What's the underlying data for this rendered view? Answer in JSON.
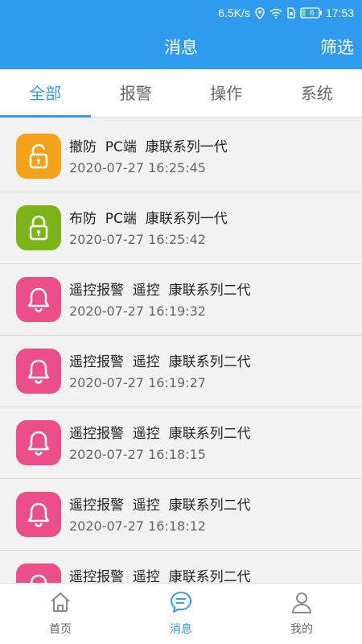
{
  "status_bar": {
    "speed": "6.5K/s",
    "battery": "6",
    "time": "17:53",
    "icons": [
      "location-icon",
      "wifi-icon",
      "sim-icon",
      "battery-icon"
    ]
  },
  "header": {
    "title": "消息",
    "filter_label": "筛选"
  },
  "tabs": [
    {
      "label": "全部",
      "active": true
    },
    {
      "label": "报警",
      "active": false
    },
    {
      "label": "操作",
      "active": false
    },
    {
      "label": "系统",
      "active": false
    }
  ],
  "messages": [
    {
      "title": "撤防  PC端  康联系列一代",
      "time": "2020-07-27 16:25:45",
      "icon": "unlock-icon",
      "color": "#f5a21b"
    },
    {
      "title": "布防  PC端  康联系列一代",
      "time": "2020-07-27 16:25:42",
      "icon": "lock-icon",
      "color": "#7cb518"
    },
    {
      "title": "遥控报警  遥控  康联系列二代",
      "time": "2020-07-27 16:19:32",
      "icon": "bell-icon",
      "color": "#ec4e8a"
    },
    {
      "title": "遥控报警  遥控  康联系列二代",
      "time": "2020-07-27 16:19:27",
      "icon": "bell-icon",
      "color": "#ec4e8a"
    },
    {
      "title": "遥控报警  遥控  康联系列二代",
      "time": "2020-07-27 16:18:15",
      "icon": "bell-icon",
      "color": "#ec4e8a"
    },
    {
      "title": "遥控报警  遥控  康联系列二代",
      "time": "2020-07-27 16:18:12",
      "icon": "bell-icon",
      "color": "#ec4e8a"
    },
    {
      "title": "遥控报警  遥控  康联系列二代",
      "time": "",
      "icon": "bell-icon",
      "color": "#ec4e8a"
    }
  ],
  "bottom_nav": [
    {
      "label": "首页",
      "icon": "home-icon",
      "active": false
    },
    {
      "label": "消息",
      "icon": "message-icon",
      "active": true
    },
    {
      "label": "我的",
      "icon": "profile-icon",
      "active": false
    }
  ],
  "colors": {
    "primary": "#2f9bef",
    "orange": "#f5a21b",
    "green": "#7cb518",
    "pink": "#ec4e8a"
  }
}
